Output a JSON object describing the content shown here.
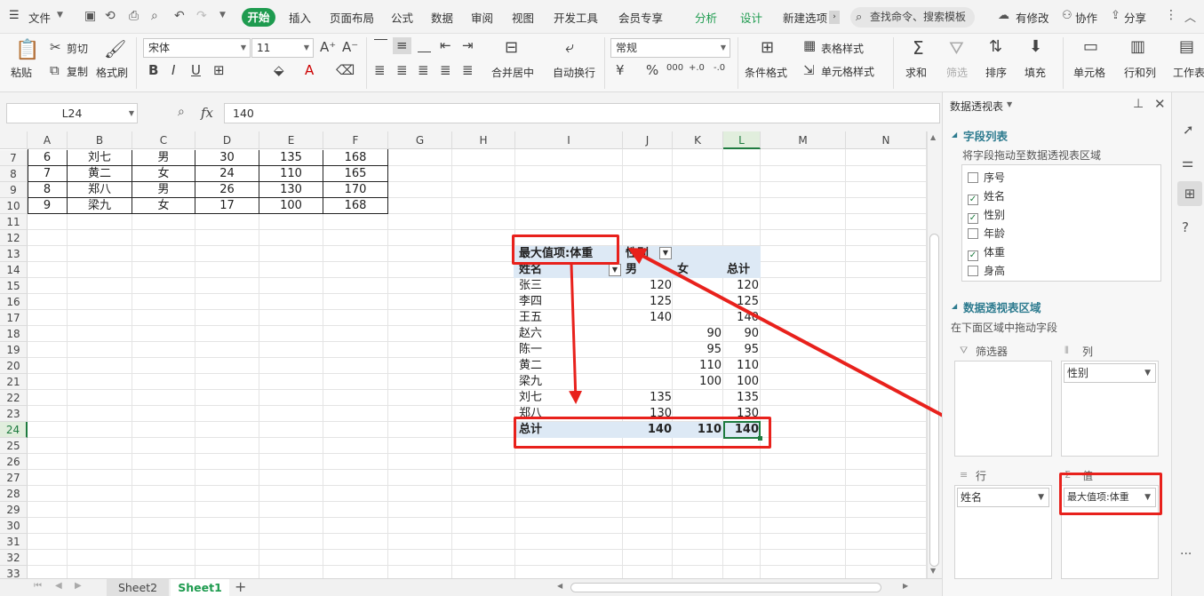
{
  "menu": {
    "file": "文件",
    "tabs": [
      "开始",
      "插入",
      "页面布局",
      "公式",
      "数据",
      "审阅",
      "视图",
      "开发工具",
      "会员专享"
    ],
    "context_tabs": [
      "分析",
      "设计"
    ],
    "new_tab": "新建选项",
    "search": "查找命令、搜索模板",
    "right": [
      "有修改",
      "协作",
      "分享"
    ]
  },
  "ribbon": {
    "paste": "粘贴",
    "cut": "剪切",
    "copy": "复制",
    "format_painter": "格式刷",
    "font_name": "宋体",
    "font_size": "11",
    "merge": "合并居中",
    "wrap": "自动换行",
    "number_format": "常规",
    "cond_format": "条件格式",
    "table_style": "表格样式",
    "cell_style": "单元格样式",
    "sum": "求和",
    "filter": "筛选",
    "sort": "排序",
    "fill": "填充",
    "cell": "单元格",
    "rowcol": "行和列",
    "worksheet": "工作表"
  },
  "formula_bar": {
    "name_box": "L24",
    "fx": "fx",
    "value": "140"
  },
  "columns": [
    "A",
    "B",
    "C",
    "D",
    "E",
    "F",
    "G",
    "H",
    "I",
    "J",
    "K",
    "L",
    "M",
    "N"
  ],
  "rows": [
    "7",
    "8",
    "9",
    "10",
    "11",
    "12",
    "13",
    "14",
    "15",
    "16",
    "17",
    "18",
    "19",
    "20",
    "21",
    "22",
    "23",
    "24",
    "25",
    "26",
    "27",
    "28",
    "29",
    "30",
    "31",
    "32",
    "33"
  ],
  "table_rows": [
    [
      "6",
      "刘七",
      "男",
      "30",
      "135",
      "168"
    ],
    [
      "7",
      "黄二",
      "女",
      "24",
      "110",
      "165"
    ],
    [
      "8",
      "郑八",
      "男",
      "26",
      "130",
      "170"
    ],
    [
      "9",
      "梁九",
      "女",
      "17",
      "100",
      "168"
    ]
  ],
  "pivot": {
    "value_label": "最大值项:体重",
    "col_field": "性别",
    "row_field": "姓名",
    "col_headers": [
      "男",
      "女",
      "总计"
    ],
    "rows": [
      [
        "张三",
        "120",
        "",
        "120"
      ],
      [
        "李四",
        "125",
        "",
        "125"
      ],
      [
        "王五",
        "140",
        "",
        "140"
      ],
      [
        "赵六",
        "",
        "90",
        "90"
      ],
      [
        "陈一",
        "",
        "95",
        "95"
      ],
      [
        "黄二",
        "",
        "110",
        "110"
      ],
      [
        "梁九",
        "",
        "100",
        "100"
      ],
      [
        "刘七",
        "135",
        "",
        "135"
      ],
      [
        "郑八",
        "130",
        "",
        "130"
      ]
    ],
    "total": [
      "总计",
      "140",
      "110",
      "140"
    ]
  },
  "sheets": [
    "Sheet2",
    "Sheet1"
  ],
  "panel": {
    "title": "数据透视表",
    "field_section": "字段列表",
    "field_hint": "将字段拖动至数据透视表区域",
    "fields": [
      {
        "name": "序号",
        "checked": false
      },
      {
        "name": "姓名",
        "checked": true
      },
      {
        "name": "性别",
        "checked": true
      },
      {
        "name": "年龄",
        "checked": false
      },
      {
        "name": "体重",
        "checked": true
      },
      {
        "name": "身高",
        "checked": false
      }
    ],
    "area_section": "数据透视表区域",
    "area_hint": "在下面区域中拖动字段",
    "filter_label": "筛选器",
    "column_label": "列",
    "column_value": "性别",
    "row_label": "行",
    "row_value": "姓名",
    "value_label": "值",
    "value_value": "最大值项:体重"
  },
  "colors": {
    "accent": "#1e9b4f",
    "highlight": "#e8211c",
    "pivot_fill": "#dde9f5"
  }
}
